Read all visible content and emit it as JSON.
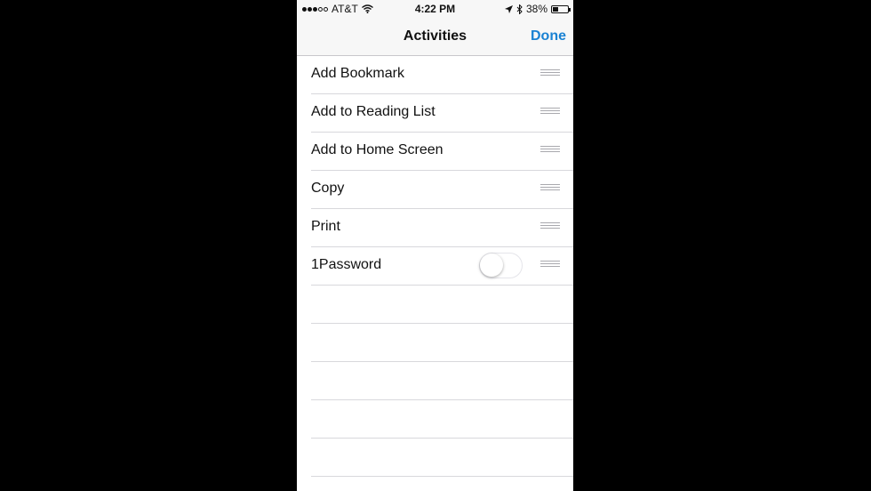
{
  "status_bar": {
    "carrier": "AT&T",
    "signal_icon": "signal-dots-icon",
    "wifi_icon": "wifi-icon",
    "time": "4:22 PM",
    "location_icon": "location-arrow-icon",
    "bluetooth_icon": "bluetooth-icon",
    "battery_percent": "38%",
    "battery_level": 0.38
  },
  "nav": {
    "title": "Activities",
    "done_label": "Done",
    "accent_color": "#1a82d3"
  },
  "activities": [
    {
      "label": "Add Bookmark"
    },
    {
      "label": "Add to Reading List"
    },
    {
      "label": "Add to Home Screen"
    },
    {
      "label": "Copy"
    },
    {
      "label": "Print"
    },
    {
      "label": "1Password",
      "toggle": false
    }
  ]
}
